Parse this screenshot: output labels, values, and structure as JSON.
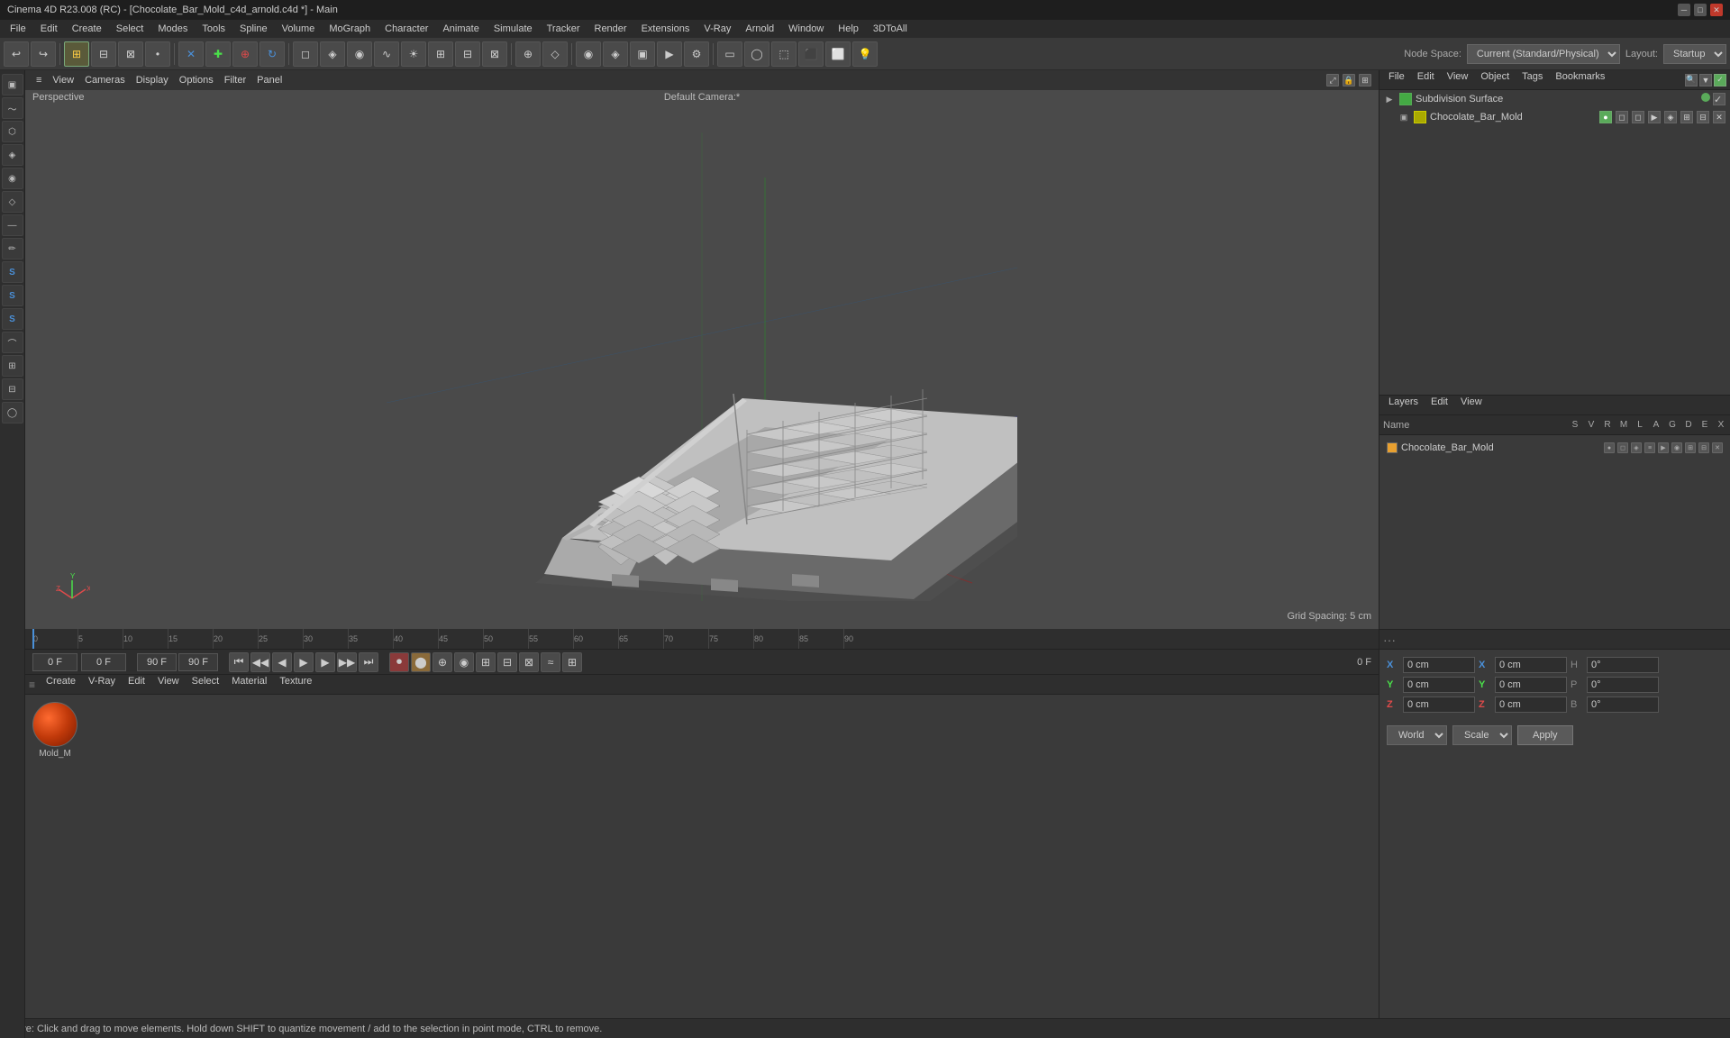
{
  "titlebar": {
    "title": "Cinema 4D R23.008 (RC) - [Chocolate_Bar_Mold_c4d_arnold.c4d *] - Main",
    "minimize": "─",
    "maximize": "□",
    "close": "✕"
  },
  "menubar": {
    "items": [
      "File",
      "Edit",
      "Create",
      "Select",
      "Modes",
      "Tools",
      "Spline",
      "Volume",
      "MoGraph",
      "Character",
      "Animate",
      "Simulate",
      "Tracker",
      "Render",
      "Extensions",
      "V-Ray",
      "Arnold",
      "Window",
      "Help",
      "3DToAll"
    ]
  },
  "nodespace": {
    "label": "Node Space:",
    "value": "Current (Standard/Physical)",
    "layout_label": "Layout:",
    "layout_value": "Startup"
  },
  "viewport": {
    "menus": [
      "View",
      "Cameras",
      "Display",
      "Options",
      "Filter",
      "Panel"
    ],
    "label": "Perspective",
    "camera": "Default Camera:*",
    "grid_spacing": "Grid Spacing: 5 cm"
  },
  "object_manager": {
    "toolbar": [
      "File",
      "Edit",
      "View",
      "Object",
      "Tags",
      "Bookmarks"
    ],
    "items": [
      {
        "name": "Subdivision Surface",
        "indent": 0,
        "icon": "▣",
        "color": "#5aaa5a",
        "has_children": true
      },
      {
        "name": "Chocolate_Bar_Mold",
        "indent": 1,
        "icon": "▣",
        "color": "#aaaa00",
        "has_children": false
      }
    ]
  },
  "layers": {
    "toolbar": [
      "Layers",
      "Edit",
      "View"
    ],
    "header_name": "Name",
    "header_cols": [
      "S",
      "V",
      "R",
      "M",
      "L",
      "A",
      "G",
      "D",
      "E",
      "X"
    ],
    "items": [
      {
        "name": "Chocolate_Bar_Mold",
        "color": "#e8a030"
      }
    ]
  },
  "timeline": {
    "start": "0 F",
    "end": "90 F",
    "current": "0 F",
    "markers": [
      0,
      5,
      10,
      15,
      20,
      25,
      30,
      35,
      40,
      45,
      50,
      55,
      60,
      65,
      70,
      75,
      80,
      85,
      90
    ]
  },
  "playback": {
    "frame_start": "0 F",
    "frame_current": "0 F",
    "range_start": "0 F",
    "range_end": "90 F",
    "fps_indicator": "90 F",
    "fps_value": "90 F"
  },
  "material_panel": {
    "toolbar": [
      "Create",
      "Edit",
      "View",
      "Select",
      "Material",
      "Texture"
    ],
    "materials": [
      {
        "name": "Mold_M",
        "color_type": "orange-red"
      }
    ]
  },
  "coordinates": {
    "x_label": "X",
    "y_label": "Y",
    "z_label": "Z",
    "x_val": "0 cm",
    "y_val": "0 cm",
    "z_val": "0 cm",
    "x2_label": "X",
    "y2_label": "Y",
    "z2_label": "Z",
    "x2_val": "0 cm",
    "y2_val": "0 cm",
    "z2_val": "0 cm",
    "h_label": "H",
    "p_label": "P",
    "b_label": "B",
    "h_val": "0°",
    "p_val": "0°",
    "b_val": "0°",
    "world_label": "World",
    "scale_label": "Scale",
    "apply_label": "Apply"
  },
  "status": {
    "text": "Move: Click and drag to move elements. Hold down SHIFT to quantize movement / add to the selection in point mode, CTRL to remove."
  },
  "toolbar": {
    "undo": "↩",
    "redo": "↪"
  }
}
